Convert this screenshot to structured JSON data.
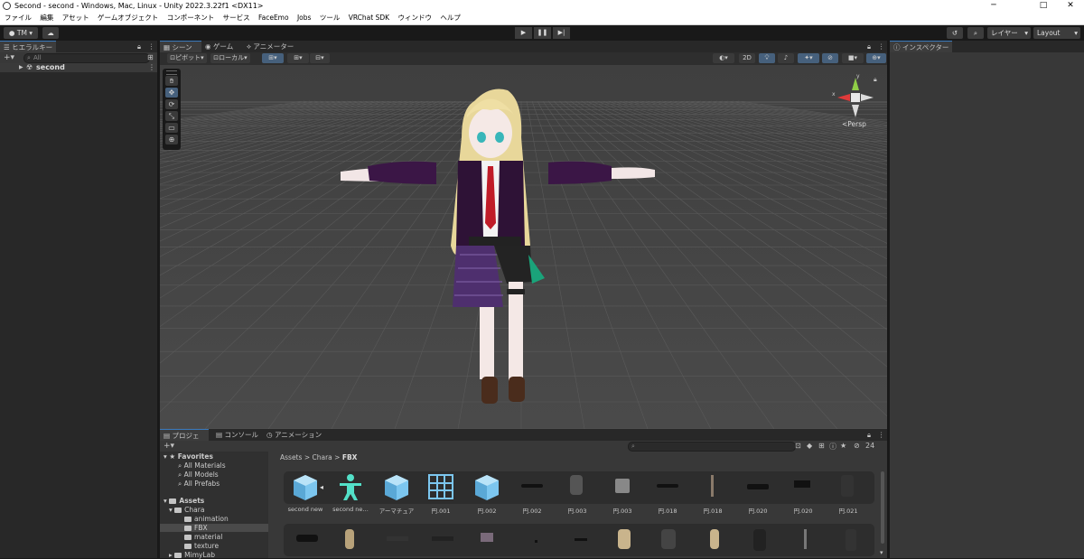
{
  "window": {
    "title": "Second - second - Windows, Mac, Linux - Unity 2022.3.22f1 <DX11>",
    "minimize": "─",
    "maximize": "□",
    "close": "✕"
  },
  "menu": [
    "ファイル",
    "編集",
    "アセット",
    "ゲームオブジェクト",
    "コンポーネント",
    "サービス",
    "FaceEmo",
    "Jobs",
    "ツール",
    "VRChat SDK",
    "ウィンドウ",
    "ヘルプ"
  ],
  "toolbar": {
    "account": "TM",
    "layers": "レイヤー",
    "layout": "Layout"
  },
  "hierarchy": {
    "tab": "ヒエラルキー",
    "search_placeholder": "All",
    "add": "+▾",
    "root": "second"
  },
  "scene_tabs": [
    "シーン",
    "ゲーム",
    "アニメーター"
  ],
  "scene_bar": {
    "pivot": "ピボット",
    "local": "ローカル",
    "mode2d": "2D"
  },
  "gizmo": {
    "persp": "<Persp",
    "y": "y",
    "x": "x"
  },
  "inspector": {
    "tab": "インスペクター"
  },
  "project_tabs": [
    "プロジェクト",
    "コンソール",
    "アニメーション"
  ],
  "project": {
    "add": "+▾",
    "breadcrumb": [
      "Assets",
      "Chara",
      "FBX"
    ],
    "breadcrumb_sep": ">",
    "visible_count": "24",
    "favorites": "Favorites",
    "favorite_items": [
      "All Materials",
      "All Models",
      "All Prefabs"
    ],
    "assets_root": "Assets",
    "tree": [
      {
        "label": "Chara",
        "indent": 1
      },
      {
        "label": "animation",
        "indent": 2
      },
      {
        "label": "FBX",
        "indent": 2,
        "selected": true
      },
      {
        "label": "material",
        "indent": 2
      },
      {
        "label": "texture",
        "indent": 2
      },
      {
        "label": "MimyLab",
        "indent": 1
      }
    ],
    "assets_row1": [
      {
        "label": "second new",
        "kind": "prefab"
      },
      {
        "label": "second ne…",
        "kind": "avatar"
      },
      {
        "label": "アーマチュア",
        "kind": "prefab"
      },
      {
        "label": "円.001",
        "kind": "grid"
      },
      {
        "label": "円.002",
        "kind": "prefab"
      },
      {
        "label": "円.002",
        "kind": "mesh"
      },
      {
        "label": "円.003",
        "kind": "mesh"
      },
      {
        "label": "円.003",
        "kind": "mesh"
      },
      {
        "label": "円.018",
        "kind": "mesh"
      },
      {
        "label": "円.018",
        "kind": "mesh"
      },
      {
        "label": "円.020",
        "kind": "mesh"
      },
      {
        "label": "円.020",
        "kind": "mesh"
      },
      {
        "label": "円.021",
        "kind": "mesh"
      }
    ],
    "assets_row2_count": 13
  },
  "colors": {
    "accent": "#3a79bb",
    "prefab_blue": "#7cc6ef",
    "avatar_cyan": "#53e0c8"
  }
}
